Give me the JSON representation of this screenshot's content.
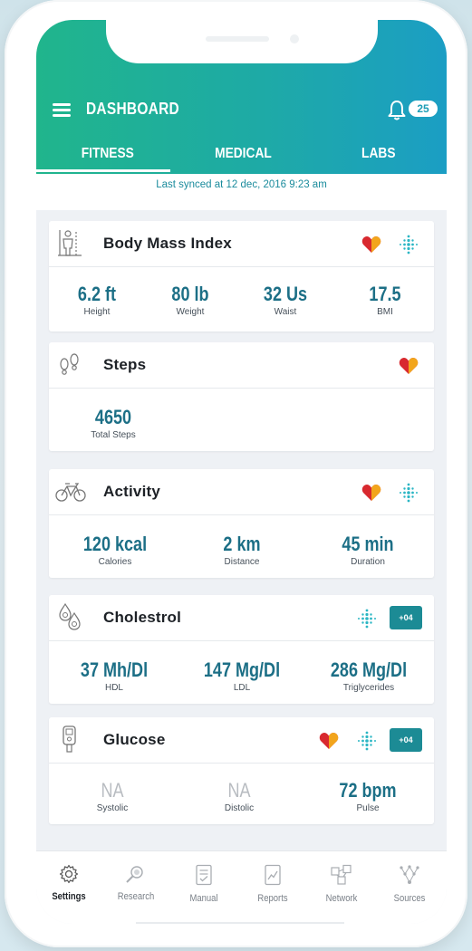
{
  "header": {
    "title": "DASHBOARD",
    "notification_count": "25",
    "tabs": [
      {
        "label": "FITNESS",
        "active": true
      },
      {
        "label": "MEDICAL",
        "active": false
      },
      {
        "label": "LABS",
        "active": false
      }
    ]
  },
  "sync_text": "Last synced at 12 dec, 2016 9:23 am",
  "cards": {
    "bmi": {
      "title": "Body Mass Index",
      "metrics": [
        {
          "value": "6.2 ft",
          "label": "Height"
        },
        {
          "value": "80 lb",
          "label": "Weight"
        },
        {
          "value": "32 Us",
          "label": "Waist"
        },
        {
          "value": "17.5",
          "label": "BMI"
        }
      ]
    },
    "steps": {
      "title": "Steps",
      "metrics": [
        {
          "value": "4650",
          "label": "Total Steps"
        }
      ]
    },
    "activity": {
      "title": "Activity",
      "metrics": [
        {
          "value": "120 kcal",
          "label": "Calories"
        },
        {
          "value": "2 km",
          "label": "Distance"
        },
        {
          "value": "45 min",
          "label": "Duration"
        }
      ]
    },
    "cholestrol": {
      "title": "Cholestrol",
      "chip": "+04",
      "metrics": [
        {
          "value": "37 Mh/Dl",
          "label": "HDL"
        },
        {
          "value": "147 Mg/Dl",
          "label": "LDL"
        },
        {
          "value": "286 Mg/Dl",
          "label": "Triglycerides"
        }
      ]
    },
    "glucose": {
      "title": "Glucose",
      "chip": "+04",
      "metrics": [
        {
          "value": "NA",
          "label": "Systolic"
        },
        {
          "value": "NA",
          "label": "Distolic"
        },
        {
          "value": "72 bpm",
          "label": "Pulse"
        }
      ]
    }
  },
  "bottom_nav": [
    {
      "label": "Settings",
      "icon": "gear-icon",
      "active": true
    },
    {
      "label": "Research",
      "icon": "research-icon",
      "active": false
    },
    {
      "label": "Manual",
      "icon": "manual-icon",
      "active": false
    },
    {
      "label": "Reports",
      "icon": "reports-icon",
      "active": false
    },
    {
      "label": "Network",
      "icon": "network-icon",
      "active": false
    },
    {
      "label": "Sources",
      "icon": "sources-icon",
      "active": false
    }
  ],
  "colors": {
    "header_start": "#20b58c",
    "header_end": "#1b9ec4",
    "metric_value": "#1c6f86",
    "chip": "#1c8b95"
  }
}
